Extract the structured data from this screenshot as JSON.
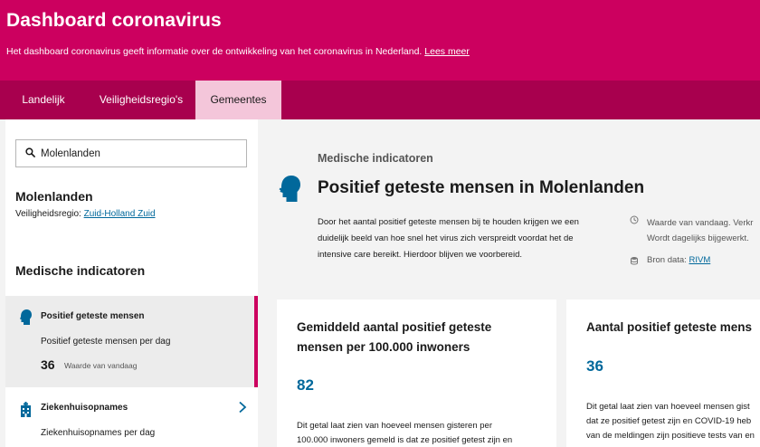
{
  "header": {
    "title": "Dashboard coronavirus",
    "intro": "Het dashboard coronavirus geeft informatie over de ontwikkeling van het coronavirus in Nederland.",
    "intro_link": "Lees meer"
  },
  "tabs": [
    {
      "label": "Landelijk"
    },
    {
      "label": "Veiligheidsregio's"
    },
    {
      "label": "Gemeentes",
      "active": true
    }
  ],
  "sidebar": {
    "search": {
      "value": "Molenlanden",
      "icon": "search-icon"
    },
    "municipality": "Molenlanden",
    "region_label": "Veiligheidsregio:",
    "region_link": "Zuid-Holland Zuid",
    "heading": "Medische indicatoren",
    "items": [
      {
        "title": "Positief geteste mensen",
        "subtitle": "Positief geteste mensen per dag",
        "value": "36",
        "value_label": "Waarde van vandaag",
        "icon": "person-head-icon",
        "active": true
      },
      {
        "title": "Ziekenhuisopnames",
        "subtitle": "Ziekenhuisopnames per dag",
        "icon": "hospital-icon"
      }
    ]
  },
  "main": {
    "kicker": "Medische indicatoren",
    "title": "Positief geteste mensen in Molenlanden",
    "description": "Door het aantal positief geteste mensen bij te houden krijgen we een duidelijk beeld van hoe snel het virus zich verspreidt voordat het de intensive care bereikt. Hierdoor blijven we voorbereid.",
    "meta_line1": "Waarde van vandaag. Verkr",
    "meta_line2": "Wordt dagelijks bijgewerkt.",
    "source_label": "Bron data:",
    "source_link": "RIVM"
  },
  "cards": [
    {
      "title_line1": "Gemiddeld aantal positief geteste",
      "title_line2": "mensen per 100.000 inwoners",
      "value": "82",
      "text_line1": "Dit getal laat zien van hoeveel mensen gisteren per",
      "text_line2": "100.000 inwoners gemeld is dat ze positief getest zijn en"
    },
    {
      "title_line1": "Aantal positief geteste mens",
      "value": "36",
      "text_line1": "Dit getal laat zien van hoeveel mensen gist",
      "text_line2": "dat ze positief getest zijn en COVID-19 heb",
      "text_line3": "van de meldingen zijn positieve tests van en"
    }
  ],
  "colors": {
    "brand": "#cc005f",
    "tabbar": "#a8004e",
    "active_tab": "#f4c6da",
    "link": "#01689b",
    "icon": "#01689b"
  }
}
